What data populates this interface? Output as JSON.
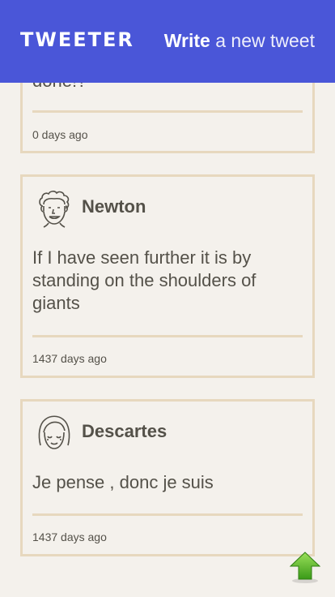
{
  "nav": {
    "brand": "TWEETER",
    "compose_bold": "Write",
    "compose_rest": " a new tweet"
  },
  "tweets": [
    {
      "text": "done!?",
      "time": "0 days ago"
    },
    {
      "author": "Newton",
      "avatar_icon": "curly-hair-face-icon",
      "text": "If I have seen further it is by standing on the shoulders of giants",
      "time": "1437 days ago"
    },
    {
      "author": "Descartes",
      "avatar_icon": "bob-hair-face-icon",
      "text": "Je pense , donc je suis",
      "time": "1437 days ago"
    }
  ],
  "scroll_top_icon": "up-arrow-icon",
  "colors": {
    "nav": "#4a56d8",
    "background": "#f4f1ec",
    "border": "#e7d8be",
    "text": "#545149",
    "arrow": "#5cbf2a"
  }
}
